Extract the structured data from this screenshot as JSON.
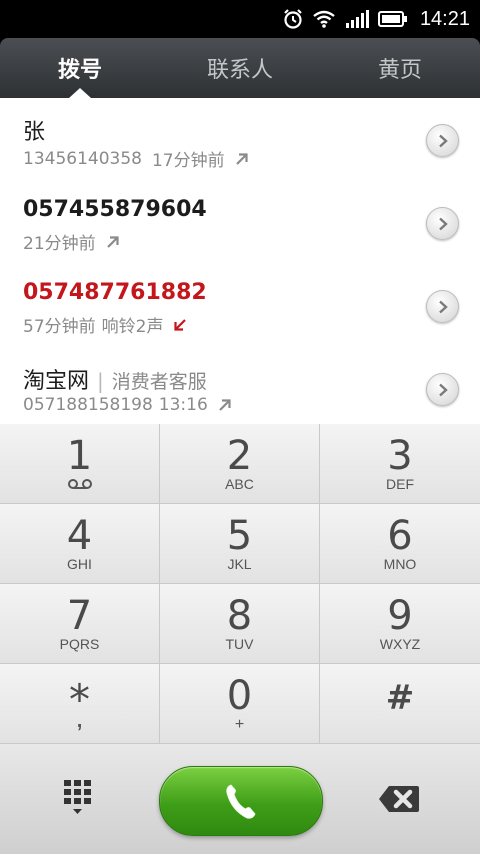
{
  "status_bar": {
    "time": "14:21",
    "icons": [
      "alarm-icon",
      "wifi-icon",
      "signal-icon",
      "battery-icon"
    ]
  },
  "tabs": [
    {
      "label": "拨号",
      "active": true
    },
    {
      "label": "联系人",
      "active": false
    },
    {
      "label": "黄页",
      "active": false
    }
  ],
  "call_log": [
    {
      "name": "张",
      "number": "13456140358",
      "time": "17分钟前",
      "type": "outgoing"
    },
    {
      "name": "057455879604",
      "time": "21分钟前",
      "type": "outgoing"
    },
    {
      "name": "057487761882",
      "time": "57分钟前",
      "extra": "响铃2声",
      "type": "missed"
    },
    {
      "name": "淘宝网",
      "separator": "|",
      "org": "消费者客服",
      "number": "057188158198",
      "time": "13:16",
      "type": "outgoing"
    }
  ],
  "keypad": [
    {
      "digit": "1",
      "letters": "",
      "extra_icon": "voicemail-icon"
    },
    {
      "digit": "2",
      "letters": "ABC"
    },
    {
      "digit": "3",
      "letters": "DEF"
    },
    {
      "digit": "4",
      "letters": "GHI"
    },
    {
      "digit": "5",
      "letters": "JKL"
    },
    {
      "digit": "6",
      "letters": "MNO"
    },
    {
      "digit": "7",
      "letters": "PQRS"
    },
    {
      "digit": "8",
      "letters": "TUV"
    },
    {
      "digit": "9",
      "letters": "WXYZ"
    },
    {
      "digit": "*",
      "letters": ","
    },
    {
      "digit": "0",
      "letters": "+"
    },
    {
      "digit": "#",
      "letters": ""
    }
  ],
  "actions": {
    "left_icon": "dialpad-grid-icon",
    "call_icon": "phone-icon",
    "right_icon": "backspace-icon"
  },
  "colors": {
    "missed": "#c3171b",
    "call_green": "#3f9e18",
    "tab_bg": "#3a3d40"
  }
}
